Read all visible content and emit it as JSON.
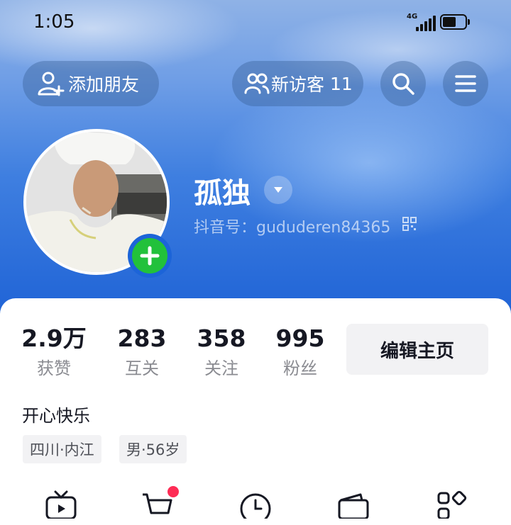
{
  "status_bar": {
    "time": "1:05",
    "network": "4G",
    "battery_level": 0.6
  },
  "top_actions": {
    "add_friend_label": "添加朋友",
    "visitors_label": "新访客",
    "visitors_count": "11",
    "search_icon": "search-icon",
    "menu_icon": "menu-icon"
  },
  "profile": {
    "name": "孤独",
    "account_id": "抖音号：gududeren84365",
    "bio": "开心快乐",
    "tags": [
      "四川·内江",
      "男·56岁"
    ]
  },
  "stats": [
    {
      "value": "2.9万",
      "label": "获赞"
    },
    {
      "value": "283",
      "label": "互关"
    },
    {
      "value": "358",
      "label": "关注"
    },
    {
      "value": "995",
      "label": "粉丝"
    }
  ],
  "edit_button_label": "编辑主页",
  "tools": [
    "tv-icon",
    "cart-icon",
    "clock-icon",
    "wallet-icon",
    "apps-icon"
  ],
  "colors": {
    "accent_green": "#22c13b",
    "notification_red": "#fe2c55",
    "header_blue": "#1f63d6"
  }
}
